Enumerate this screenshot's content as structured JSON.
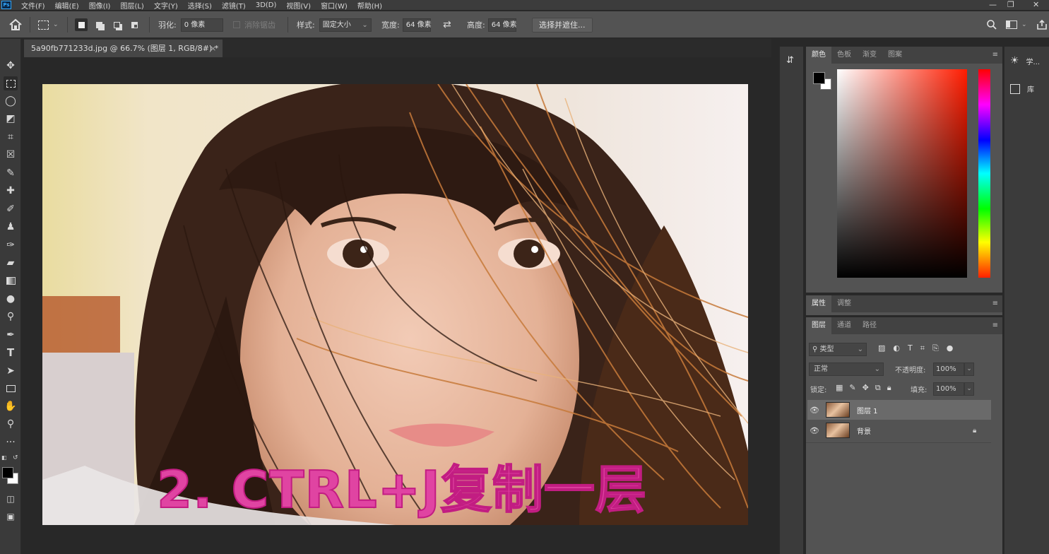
{
  "app": {
    "logo": "Ps"
  },
  "menubar": {
    "items": [
      "文件(F)",
      "编辑(E)",
      "图像(I)",
      "图层(L)",
      "文字(Y)",
      "选择(S)",
      "滤镜(T)",
      "3D(D)",
      "视图(V)",
      "窗口(W)",
      "帮助(H)"
    ],
    "minimize": "—",
    "restore": "❐",
    "close": "✕"
  },
  "options": {
    "feather_label": "羽化:",
    "feather_value": "0 像素",
    "antialias_label": "消除锯齿",
    "style_label": "样式:",
    "style_value": "固定大小",
    "width_label": "宽度:",
    "width_value": "64 像素",
    "swap_icon": "⇄",
    "height_label": "高度:",
    "height_value": "64 像素",
    "select_mask_button": "选择并遮住..."
  },
  "document": {
    "tab_title": "5a90fb771233d.jpg @ 66.7% (图层 1, RGB/8#) *",
    "tab_close": "×",
    "caption": "2. CTRL+J复制一层"
  },
  "panels": {
    "color_tabs": [
      "颜色",
      "色板",
      "渐变",
      "图案"
    ],
    "properties_tabs": [
      "属性",
      "调整"
    ],
    "layers_tabs": [
      "图层",
      "通道",
      "路径"
    ],
    "filter_kind": "类型",
    "blend_mode": "正常",
    "opacity_label": "不透明度:",
    "opacity_value": "100%",
    "lock_label": "锁定:",
    "fill_label": "填充:",
    "fill_value": "100%",
    "layers": [
      {
        "name": "图层 1",
        "selected": true,
        "locked": false
      },
      {
        "name": "背景",
        "selected": false,
        "locked": true
      }
    ]
  },
  "right_strip": {
    "learn_label": "学...",
    "library_label": "库"
  },
  "colors": {
    "accent_caption": "#e044a2",
    "foreground": "#000000",
    "background": "#ffffff"
  }
}
